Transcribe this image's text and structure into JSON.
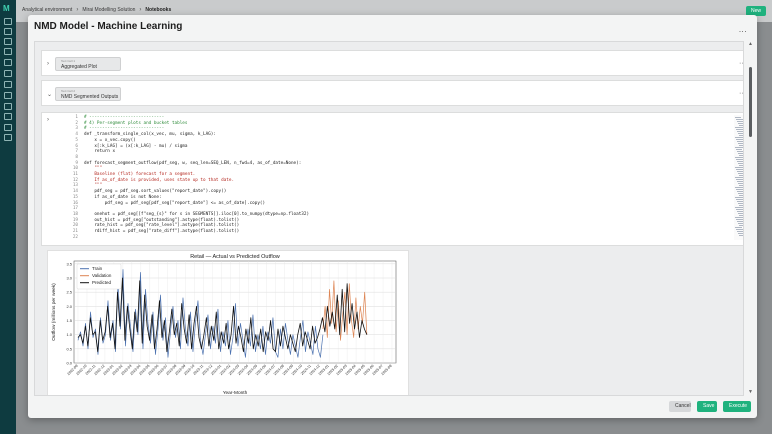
{
  "breadcrumb": {
    "items": [
      "Analytical environment",
      "Mirai Modelling Solution",
      "Notebooks"
    ]
  },
  "topbar": {
    "new_label": "New"
  },
  "modal": {
    "title": "NMD Model - Machine Learning",
    "menu_label": "...",
    "cells": [
      {
        "tag": "Text Cell 1",
        "name": "Aggregated Plot"
      },
      {
        "tag": "Text Cell 2",
        "name": "NMD Segmented Outputs"
      }
    ],
    "code_lines": [
      "# -----------------------------",
      "# 4) Per-segment plots and bucket tables",
      "# -----------------------------",
      "def _transform_single_col(x_vec, mu, sigma, k_LAG):",
      "    x = x_vec.copy()",
      "    x[:k_LAG] = (x[:k_LAG] - mu) / sigma",
      "    return x",
      "",
      "def forecast_segment_outflow(pdf_seg, w, seq_len=SEQ_LEN, n_fwd=4, as_of_date=None):",
      "    \"\"\"",
      "    Baseline (flat) forecast for a segment.",
      "    If as_of_date is provided, uses state up to that date.",
      "    \"\"\"",
      "    pdf_seg = pdf_seg.sort_values(\"report_date\").copy()",
      "    if as_of_date is not None:",
      "        pdf_seg = pdf_seg[pdf_seg[\"report_date\"] <= as_of_date].copy()",
      "",
      "    onehot = pdf_seg[[f\"seg_{s}\" for s in SEGMENTS]].iloc[0].to_numpy(dtype=np.float32)",
      "    out_hist = pdf_seg[\"outstanding\"].astype(float).tolist()",
      "    rate_hist = pdf_seg[\"rate_level\"].astype(float).tolist()",
      "    rdiff_hist = pdf_seg[\"rate_diff\"].astype(float).tolist()",
      ""
    ],
    "buttons": {
      "cancel": "Cancel",
      "save": "Save",
      "execute": "Execute"
    }
  },
  "chart_data": {
    "type": "line",
    "title": "Retail — Actual vs Predicted Outflow",
    "xlabel": "Year-Month",
    "ylabel": "Outflow (millions per week)",
    "ylim": [
      0,
      3.6
    ],
    "yticks": [
      0.0,
      0.5,
      1.0,
      1.5,
      2.0,
      2.5,
      3.0,
      3.5
    ],
    "xticks": [
      "2022-09",
      "2022-10",
      "2022-11",
      "2022-12",
      "2023-01",
      "2023-02",
      "2023-03",
      "2023-04",
      "2023-05",
      "2023-06",
      "2023-07",
      "2023-08",
      "2023-09",
      "2023-10",
      "2023-11",
      "2023-12",
      "2024-01",
      "2024-02",
      "2024-03",
      "2024-04",
      "2024-05",
      "2024-06",
      "2024-07",
      "2024-08",
      "2024-09",
      "2024-10",
      "2024-11",
      "2024-12",
      "2025-01",
      "2025-02",
      "2025-03",
      "2025-04",
      "2025-05",
      "2025-06",
      "2025-07",
      "2025-08"
    ],
    "grid": true,
    "legend": "top-left",
    "series": [
      {
        "name": "Train",
        "color": "#4c72b0",
        "values": [
          0.8,
          1.1,
          0.6,
          1.4,
          0.5,
          1.8,
          0.9,
          1.2,
          0.3,
          1.6,
          0.7,
          1.0,
          2.2,
          0.8,
          1.5,
          0.4,
          2.8,
          1.2,
          3.3,
          0.6,
          2.1,
          1.3,
          0.4,
          1.9,
          1.0,
          3.2,
          0.5,
          2.6,
          1.4,
          0.7,
          1.8,
          0.3,
          1.2,
          2.4,
          0.8,
          1.6,
          0.2,
          1.1,
          2.0,
          0.9,
          1.5,
          0.5,
          2.3,
          1.2,
          0.6,
          1.8,
          0.4,
          1.4,
          2.2,
          0.8,
          0.3,
          1.0,
          1.7,
          0.5,
          1.3,
          0.7,
          1.9,
          0.4,
          1.1,
          0.6,
          1.5,
          0.3,
          0.9,
          2.1,
          0.6,
          1.4,
          0.8,
          0.2,
          1.2,
          0.6,
          1.7,
          0.4,
          1.0,
          0.5,
          1.3,
          0.3,
          1.1,
          0.7,
          1.6,
          0.4,
          0.2,
          1.2,
          0.5,
          1.4,
          0.8,
          0.3,
          1.0,
          0.6,
          0.2,
          0.9,
          1.5,
          0.4,
          1.1,
          0.7,
          0.3,
          1.3,
          0.5,
          0.2,
          1.0
        ]
      },
      {
        "name": "Validation",
        "color": "#dd8452",
        "values": [
          1.2,
          2.0,
          0.9,
          2.6,
          1.4,
          2.9,
          1.1,
          2.2,
          0.8,
          1.7,
          2.5,
          1.0,
          2.8,
          1.5,
          0.9,
          2.3,
          1.2,
          2.0,
          1.4,
          2.5,
          1.0
        ]
      },
      {
        "name": "Predicted",
        "color": "#111111",
        "values": [
          0.9,
          1.0,
          0.7,
          1.3,
          0.6,
          1.6,
          1.0,
          1.1,
          0.4,
          1.5,
          0.8,
          1.1,
          2.0,
          0.9,
          1.4,
          0.5,
          2.5,
          1.3,
          3.0,
          0.8,
          2.0,
          1.2,
          0.5,
          1.8,
          1.1,
          2.9,
          0.7,
          2.4,
          1.3,
          0.8,
          1.7,
          0.5,
          1.2,
          2.2,
          0.9,
          1.5,
          0.4,
          1.1,
          1.9,
          1.0,
          1.4,
          0.6,
          2.1,
          1.2,
          0.7,
          1.7,
          0.5,
          1.4,
          2.0,
          0.9,
          0.5,
          1.0,
          1.6,
          0.6,
          1.3,
          0.8,
          1.8,
          0.5,
          1.1,
          0.7,
          1.4,
          0.5,
          1.0,
          2.0,
          0.7,
          1.3,
          0.9,
          0.4,
          1.2,
          0.7,
          1.6,
          0.5,
          1.0,
          0.6,
          1.2,
          0.4,
          1.1,
          0.8,
          1.5,
          0.5,
          0.4,
          1.2,
          0.6,
          1.3,
          0.9,
          0.5,
          1.0,
          0.7,
          0.4,
          1.0,
          1.4,
          0.6,
          1.1,
          0.8,
          0.5,
          1.3,
          0.7,
          0.9,
          1.2,
          1.6,
          1.1,
          2.0,
          1.3,
          1.8,
          1.2,
          2.4,
          1.0,
          2.6,
          1.1,
          2.8,
          1.4,
          2.1,
          1.2,
          1.8,
          0.9,
          1.5,
          1.2,
          1.0
        ]
      }
    ]
  }
}
